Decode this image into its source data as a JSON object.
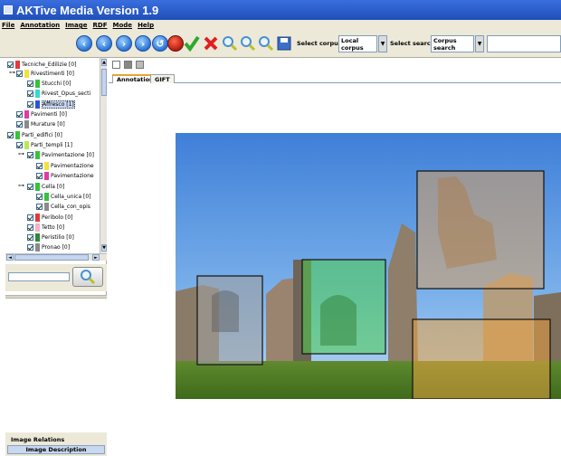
{
  "window": {
    "title": "AKTive Media Version 1.9"
  },
  "menu": [
    "File",
    "Annotation",
    "Image",
    "RDF",
    "Mode",
    "Help"
  ],
  "toolbar": {
    "corpus_label": "Select corpus:",
    "corpus_value": "Local corpus",
    "search_label": "Select search:",
    "search_value": "Corpus search"
  },
  "tree": [
    {
      "label": "Tecniche_Edilizie [0]",
      "color": "#e23a3a"
    },
    {
      "label": "Rivestimenti [0]",
      "color": "#f4e13a"
    },
    {
      "label": "Stucchi [0]",
      "color": "#37c23a"
    },
    {
      "label": "Rivest_Opus_secti",
      "color": "#37d6d6"
    },
    {
      "label": "Affresco [1]",
      "color": "#2d55d8"
    },
    {
      "label": "Pavimenti [0]",
      "color": "#e23aa2"
    },
    {
      "label": "Murature [0]",
      "color": "#8a8a8a"
    },
    {
      "label": "Parti_edifici [0]",
      "color": "#37c23a"
    },
    {
      "label": "Parti_templi [1]",
      "color": "#b9e84f"
    },
    {
      "label": "Pavimentazione [0]",
      "color": "#37c23a"
    },
    {
      "label": "Pavimentazione",
      "color": "#f4e13a"
    },
    {
      "label": "Pavimentazione",
      "color": "#e23aa2"
    },
    {
      "label": "Cella [0]",
      "color": "#37c23a"
    },
    {
      "label": "Cella_unica [0]",
      "color": "#37c23a"
    },
    {
      "label": "Cella_con_opis",
      "color": "#8a8a8a"
    },
    {
      "label": "Peribolo [0]",
      "color": "#e23a3a"
    },
    {
      "label": "Tetto [0]",
      "color": "#f4b0d0"
    },
    {
      "label": "Peristilio [0]",
      "color": "#2a8a3a"
    },
    {
      "label": "Pronao [0]",
      "color": "#8a8a8a"
    }
  ],
  "bottom_tabs": [
    "Image Relations",
    "Image Description"
  ],
  "main_tabs": [
    "Annotation",
    "GIFT"
  ],
  "annotations": [
    {
      "color": "#a0a0a0",
      "meaning": "gray region"
    },
    {
      "color": "#4fd04f",
      "meaning": "green region"
    },
    {
      "color": "#d9a060",
      "meaning": "tan region"
    },
    {
      "color": "#e8a040",
      "meaning": "orange region"
    }
  ]
}
